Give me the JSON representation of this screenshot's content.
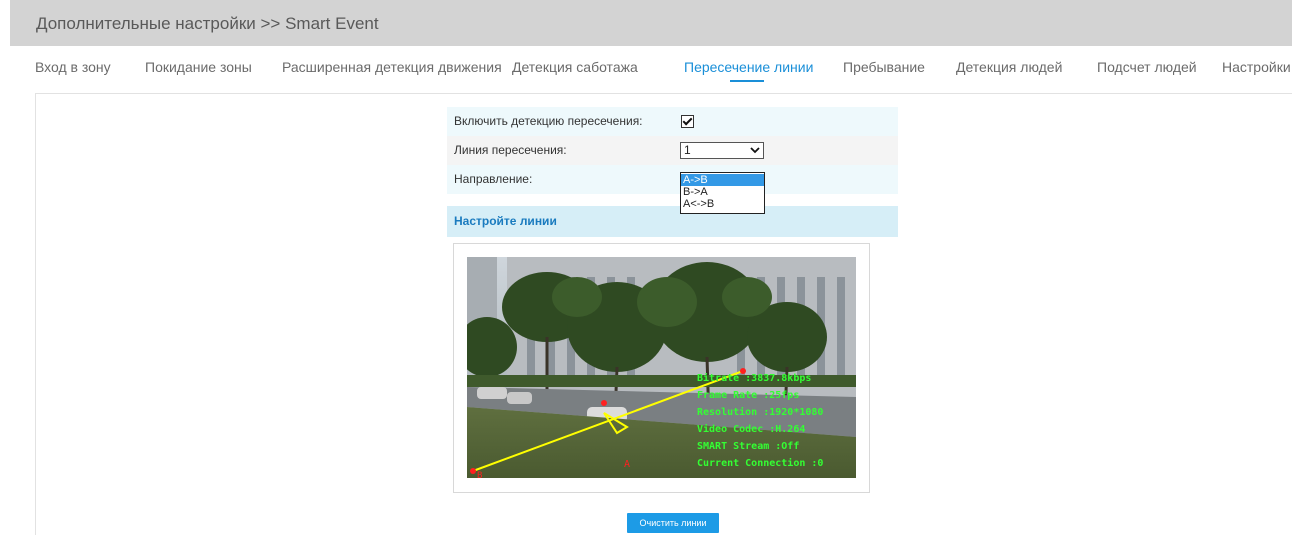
{
  "header": {
    "title": "Дополнительные настройки >> Smart Event"
  },
  "tabs": [
    {
      "label": "Вход в зону"
    },
    {
      "label": "Покидание зоны"
    },
    {
      "label": "Расширенная детекция движения"
    },
    {
      "label": "Детекция саботажа"
    },
    {
      "label": "Пересечение линии",
      "active": true
    },
    {
      "label": "Пребывание"
    },
    {
      "label": "Детекция людей"
    },
    {
      "label": "Подсчет людей"
    },
    {
      "label": "Настройки"
    }
  ],
  "form": {
    "enable_label": "Включить детекцию пересечения:",
    "enable_checked": true,
    "line_label": "Линия пересечения:",
    "line_value": "1",
    "direction_label": "Направление:",
    "direction_options": [
      "A->B",
      "B->A",
      "A<->B"
    ],
    "direction_selected": "A->B"
  },
  "section": {
    "title": "Настройте линии"
  },
  "video_overlay": {
    "lines": [
      "Bitrate :3837.8kbps",
      "Frame Rate :25fps",
      "Resolution :1920*1080",
      "Video Codec :H.264",
      "SMART Stream :Off",
      "Current Connection :0"
    ],
    "point_a": "A",
    "point_b": "B"
  },
  "buttons": {
    "clear_lines": "Очистить линии"
  },
  "colors": {
    "accent": "#1a8fd8",
    "overlay_text": "#33ff33",
    "line": "#ffff00"
  }
}
